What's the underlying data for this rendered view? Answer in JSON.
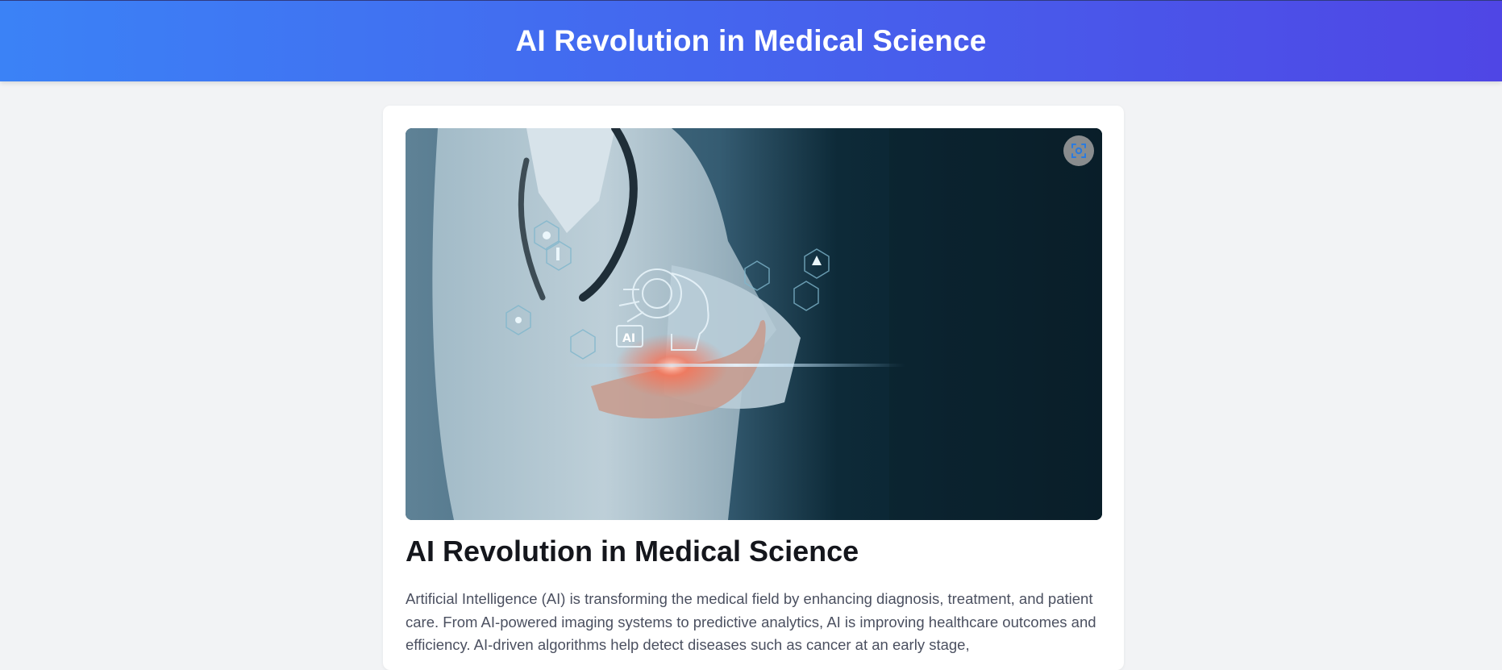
{
  "header": {
    "title": "AI Revolution in Medical Science"
  },
  "article": {
    "hero_image": {
      "alt": "Doctor holding a holographic AI brain with medical icons",
      "fullscreen_icon": "fullscreen-icon"
    },
    "title": "AI Revolution in Medical Science",
    "body": "Artificial Intelligence (AI) is transforming the medical field by enhancing diagnosis, treatment, and patient care. From AI-powered imaging systems to predictive analytics, AI is improving healthcare outcomes and efficiency. AI-driven algorithms help detect diseases such as cancer at an early stage,"
  },
  "colors": {
    "header_gradient_start": "#3b82f6",
    "header_gradient_end": "#4f46e5",
    "page_background": "#f2f3f5",
    "title_text": "#14161c",
    "body_text": "#4b5060"
  }
}
